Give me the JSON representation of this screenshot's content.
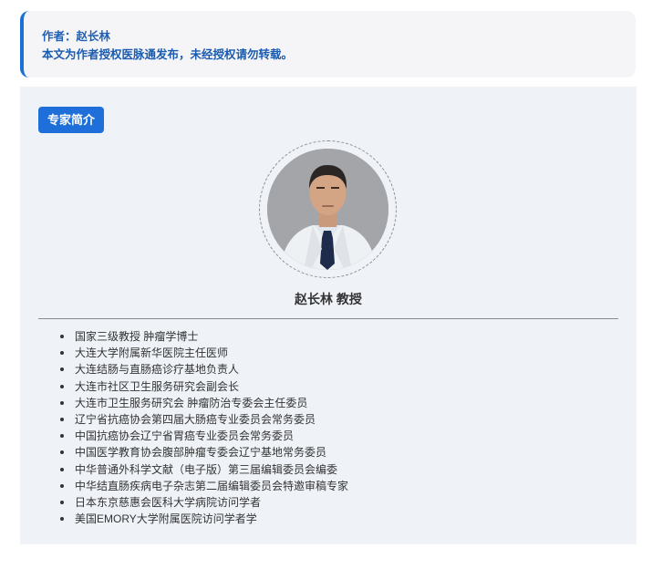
{
  "author": {
    "line1": "作者：赵长林",
    "line2": "本文为作者授权医脉通发布，未经授权请勿转载。"
  },
  "profile": {
    "section_label": "专家简介",
    "name": "赵长林 教授",
    "credentials": [
      "国家三级教授 肿瘤学博士",
      "大连大学附属新华医院主任医师",
      "大连结肠与直肠癌诊疗基地负责人",
      "大连市社区卫生服务研究会副会长",
      "大连市卫生服务研究会 肿瘤防治专委会主任委员",
      "辽宁省抗癌协会第四届大肠癌专业委员会常务委员",
      "中国抗癌协会辽宁省胃癌专业委员会常务委员",
      "中国医学教育协会腹部肿瘤专委会辽宁基地常务委员",
      "中华普通外科学文献（电子版）第三届编辑委员会编委",
      "中华结直肠疾病电子杂志第二届编辑委员会特邀审稿专家",
      "日本东京慈惠会医科大学病院访问学者",
      "美国EMORY大学附属医院访问学者学"
    ]
  },
  "colors": {
    "accent": "#1e6fd9",
    "author_text": "#1f5fb4",
    "card_bg": "#eff3f8"
  }
}
